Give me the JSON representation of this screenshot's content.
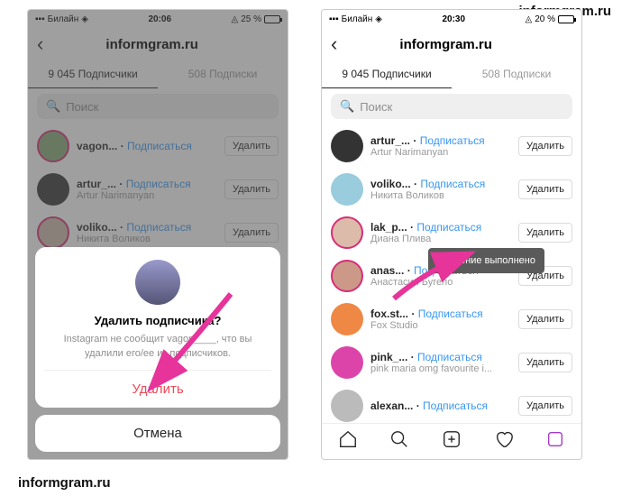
{
  "watermark": "informgram.ru",
  "common": {
    "carrier": "Билайн",
    "account": "informgram.ru",
    "followers_tab": "9 045 Подписчики",
    "following_tab": "508 Подписки",
    "search_placeholder": "Поиск",
    "follow_label": "Подписаться",
    "remove_label": "Удалить"
  },
  "left": {
    "time": "20:06",
    "battery_pct": "25 %",
    "list": [
      {
        "username": "vagon...",
        "subtitle": ""
      },
      {
        "username": "artur_...",
        "subtitle": "Artur Narimanyan"
      },
      {
        "username": "voliko...",
        "subtitle": "Никита Воликов"
      }
    ],
    "modal": {
      "title": "Удалить подписчика?",
      "text": "Instagram не сообщит vagon____, что вы удалили его/ее из подписчиков.",
      "confirm": "Удалить",
      "cancel": "Отмена"
    }
  },
  "right": {
    "time": "20:30",
    "battery_pct": "20 %",
    "toast": "Удаление выполнено",
    "list": [
      {
        "username": "artur_...",
        "subtitle": "Artur Narimanyan"
      },
      {
        "username": "voliko...",
        "subtitle": "Никита Воликов"
      },
      {
        "username": "lak_p...",
        "subtitle": "Диана Плива"
      },
      {
        "username": "anas...",
        "subtitle": "Анастасия Бугело"
      },
      {
        "username": "fox.st...",
        "subtitle": "Fox Studio"
      },
      {
        "username": "pink_...",
        "subtitle": "pink maria omg favourite i..."
      },
      {
        "username": "alexan...",
        "subtitle": ""
      }
    ]
  }
}
